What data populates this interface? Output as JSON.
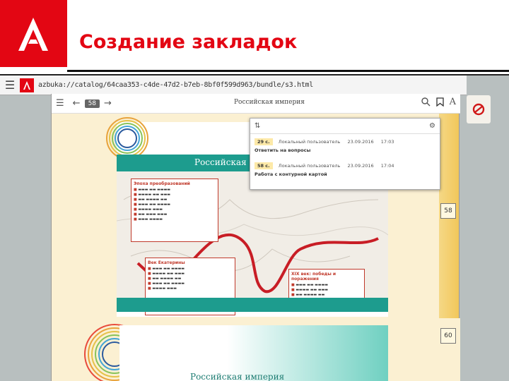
{
  "slide": {
    "title": "Создание закладок",
    "brand_color": "#e30613"
  },
  "browser": {
    "url": "azbuka://catalog/64caa353-c4de-47d2-b7eb-8bf0f599d963/bundle/s3.html",
    "menu_icon": "hamburger-icon"
  },
  "reader": {
    "page_label": "58",
    "book_title": "Российская империя",
    "font_label": "A"
  },
  "book": {
    "section_title": "Российская",
    "lower_title": "Российская империя",
    "page_markers": [
      "58",
      "60"
    ],
    "cards": [
      {
        "title": "Эпоха преобразований",
        "items": [
          "",
          "",
          "",
          "",
          "",
          "",
          "",
          ""
        ]
      },
      {
        "title": "Век Екатерины",
        "items": [
          "",
          "",
          "",
          "",
          ""
        ]
      },
      {
        "title": "XIX век: победы и поражения",
        "items": [
          "",
          "",
          ""
        ]
      }
    ]
  },
  "bookmarks": {
    "rows": [
      {
        "page": "29 с.",
        "user": "Локальный пользователь",
        "date": "23.09.2016",
        "time": "17:03",
        "note": "Ответить на вопросы"
      },
      {
        "page": "58 с.",
        "user": "Локальный пользователь",
        "date": "23.09.2016",
        "time": "17:04",
        "note": "Работа с контурной картой"
      }
    ]
  },
  "colors": {
    "teal": "#1d9c8e",
    "red": "#c0392b",
    "bookmark_tag": "#fde9a8"
  }
}
